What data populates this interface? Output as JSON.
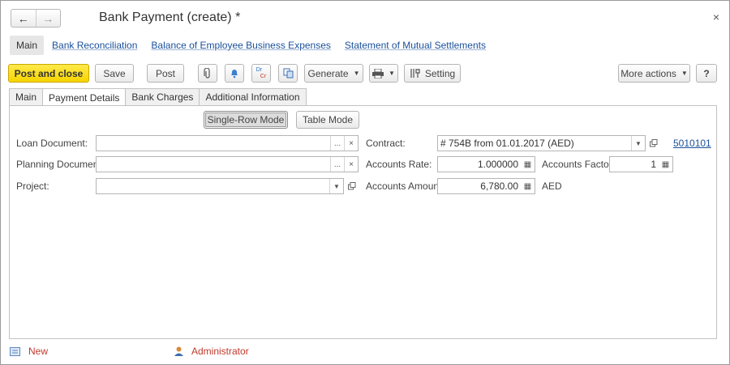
{
  "window": {
    "title": "Bank Payment (create) *"
  },
  "nav": {
    "main": "Main",
    "links": [
      "Bank Reconciliation",
      "Balance of Employee Business Expenses",
      "Statement of Mutual Settlements"
    ]
  },
  "toolbar": {
    "post_and_close": "Post and close",
    "save": "Save",
    "post": "Post",
    "generate": "Generate",
    "setting": "Setting",
    "more_actions": "More actions",
    "help": "?",
    "dr_label": "Dr",
    "cr_label": "Cr"
  },
  "tabs": [
    "Main",
    "Payment Details",
    "Bank Charges",
    "Additional Information"
  ],
  "active_tab": "Payment Details",
  "modes": {
    "single_row": "Single-Row Mode",
    "table": "Table Mode"
  },
  "form": {
    "loan_document": {
      "label": "Loan Document:",
      "value": ""
    },
    "planning_document": {
      "label": "Planning Document:",
      "value": ""
    },
    "project": {
      "label": "Project:",
      "value": ""
    },
    "contract": {
      "label": "Contract:",
      "value": "# 754B from 01.01.2017 (AED)",
      "link": "5010101"
    },
    "accounts_rate": {
      "label": "Accounts Rate:",
      "value": "1.000000"
    },
    "accounts_factor": {
      "label": "Accounts Factor:",
      "value": "1"
    },
    "accounts_amount": {
      "label": "Accounts Amount:",
      "value": "6,780.00",
      "currency": "AED"
    }
  },
  "footer": {
    "status": "New",
    "user": "Administrator"
  },
  "colors": {
    "primary_button": "#f6d500",
    "link": "#1a4f9b",
    "footer_text": "#c0392b"
  }
}
